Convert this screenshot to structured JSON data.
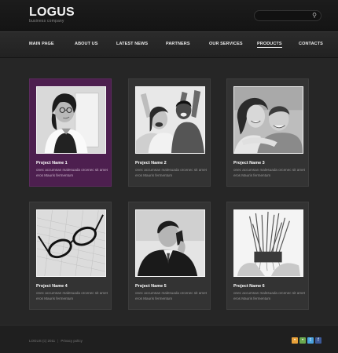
{
  "header": {
    "logo": "LOGUS",
    "tagline": "business company",
    "search_placeholder": ""
  },
  "nav": {
    "items": [
      {
        "label": "MAIN PAGE",
        "active": false
      },
      {
        "label": "ABOUT US",
        "active": false
      },
      {
        "label": "LATEST NEWS",
        "active": false
      },
      {
        "label": "PARTNERS",
        "active": false
      },
      {
        "label": "OUR SERVICES",
        "active": false
      },
      {
        "label": "PRODUCTS",
        "active": true
      },
      {
        "label": "CONTACTS",
        "active": false
      }
    ]
  },
  "projects": [
    {
      "title": "Project Name 1",
      "desc": "onec accumsan malesuada orcenec sit amet eros Mauris fermentum",
      "photo": "woman-with-glasses",
      "highlight": true
    },
    {
      "title": "Project Name 2",
      "desc": "onec accumsan malesuada orcenec sit amet eros Mauris fermentum",
      "photo": "cheering-couple",
      "highlight": false
    },
    {
      "title": "Project Name 3",
      "desc": "onec accumsan malesuada orcenec sit amet eros Mauris fermentum",
      "photo": "smiling-couple",
      "highlight": false
    },
    {
      "title": "Project Name 4",
      "desc": "onec accumsan malesuada orcenec sit amet eros Mauris fermentum",
      "photo": "glasses-on-paper",
      "highlight": false
    },
    {
      "title": "Project Name 5",
      "desc": "onec accumsan malesuada orcenec sit amet eros Mauris fermentum",
      "photo": "man-on-phone",
      "highlight": false
    },
    {
      "title": "Project Name 6",
      "desc": "onec accumsan malesuada orcenec sit amet eros Mauris fermentum",
      "photo": "plant-in-hands",
      "highlight": false
    }
  ],
  "footer": {
    "copyright": "LOGUS (c) 2011",
    "separator": "|",
    "privacy": "Privacy policy",
    "social": [
      {
        "name": "rss-icon",
        "color": "#e8a13a"
      },
      {
        "name": "share-icon",
        "color": "#6aa84f"
      },
      {
        "name": "twitter-icon",
        "color": "#4aa3df"
      },
      {
        "name": "facebook-icon",
        "color": "#3b5998"
      }
    ]
  },
  "colors": {
    "background": "#262626",
    "highlight_card": "#4d1f4f",
    "card": "#333333"
  }
}
